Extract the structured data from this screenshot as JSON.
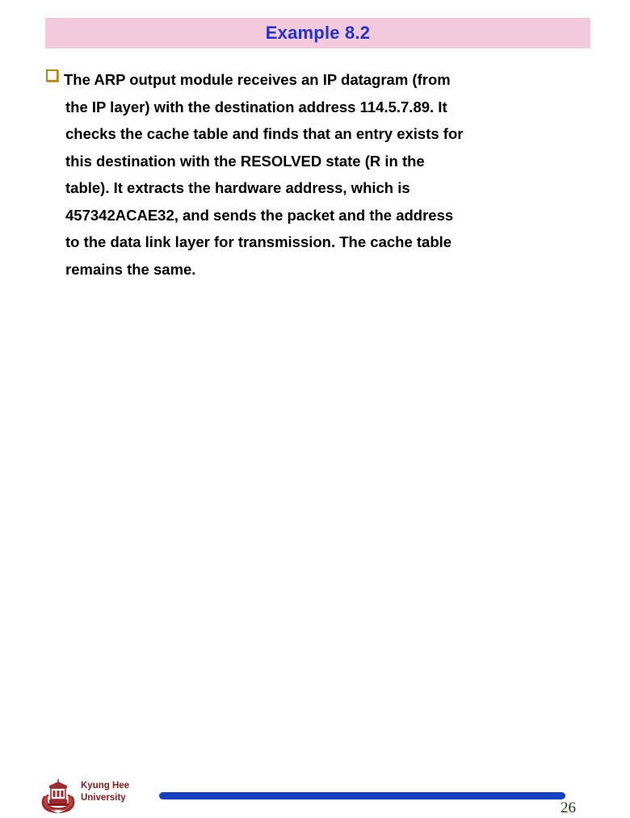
{
  "slide": {
    "title": "Example 8.2",
    "title_color": "#2233cc",
    "banner_color": "#f3cadc",
    "background_color": "#ffffff"
  },
  "body": {
    "bullet_glyph": "hollow-square",
    "bullet_color": "#b8860b",
    "text_color": "#000000",
    "full_text": "The ARP output module receives an IP datagram (from the IP layer) with the destination address 114.5.7.89. It checks the cache table and finds that an entry exists for this destination with the RESOLVED state (R in the table). It extracts the hardware address, which is 457342ACAE32, and sends the packet and the address to the data link layer for transmission. The cache table remains the same.",
    "lines": [
      "The ARP output module receives an IP datagram (from",
      "the IP layer) with the destination address 114.5.7.89. It",
      "checks the cache table and finds that an entry exists for",
      "this destination with the RESOLVED state (R in the",
      "table). It extracts the hardware address, which is",
      "457342ACAE32, and sends the packet and the address",
      "to the data link layer for transmission. The cache table",
      "remains the same."
    ]
  },
  "footer": {
    "institution_line1": "Kyung Hee",
    "institution_line2": "University",
    "institution_color": "#8b1a1a",
    "bar_color": "#1540c4",
    "page_number": "26",
    "page_number_color": "#1a3a1a"
  }
}
